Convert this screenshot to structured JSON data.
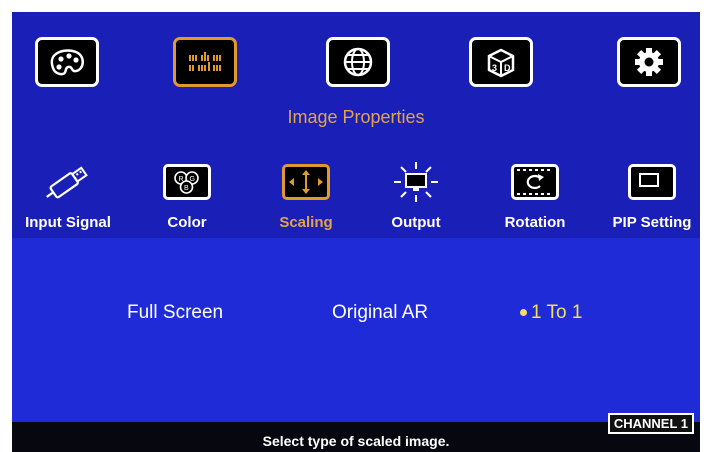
{
  "menu": {
    "tabs": [
      {
        "icon": "palette-icon",
        "active": false
      },
      {
        "icon": "image-properties-icon",
        "active": true
      },
      {
        "icon": "globe-icon",
        "active": false
      },
      {
        "icon": "3d-icon",
        "active": false
      },
      {
        "icon": "gear-icon",
        "active": false
      }
    ],
    "section_title": "Image Properties"
  },
  "submenu": {
    "items": [
      {
        "label": "Input Signal",
        "icon": "usb-plug-icon",
        "active": false
      },
      {
        "label": "Color",
        "icon": "rgb-circles-icon",
        "active": false
      },
      {
        "label": "Scaling",
        "icon": "scaling-arrows-icon",
        "active": true
      },
      {
        "label": "Output",
        "icon": "output-monitor-icon",
        "active": false
      },
      {
        "label": "Rotation",
        "icon": "rotation-icon",
        "active": false
      },
      {
        "label": "PIP Setting",
        "icon": "pip-window-icon",
        "active": false
      }
    ]
  },
  "options": {
    "items": [
      "Full Screen",
      "Original AR",
      "1 To 1"
    ],
    "selected": "1 To 1"
  },
  "status": {
    "channel": "CHANNEL 1",
    "hint": "Select type of scaled image."
  },
  "colors": {
    "top_bg": "#1a1fb8",
    "bottom_bg": "#1e2bd6",
    "accent": "#e3a34a",
    "selected": "#f2e25a"
  }
}
